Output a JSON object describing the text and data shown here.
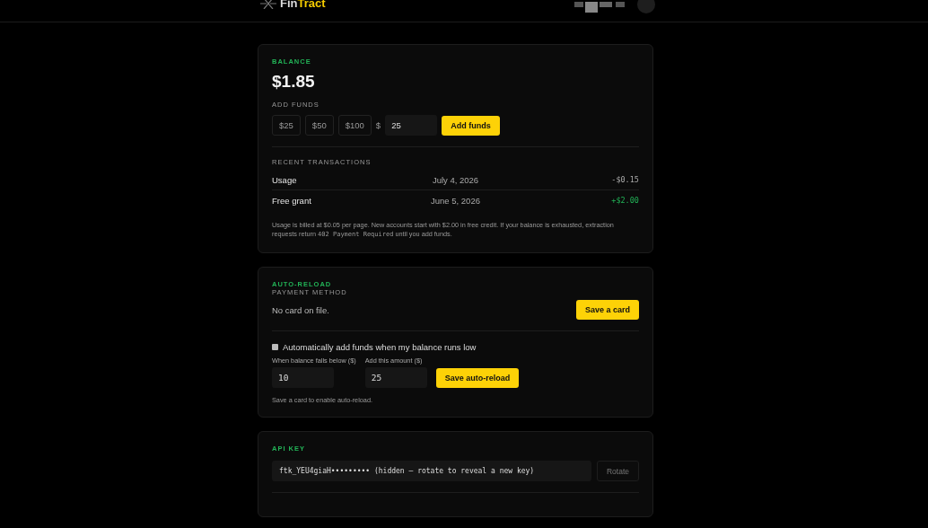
{
  "header": {
    "brand": {
      "text": "Fin",
      "accent": "Tract"
    }
  },
  "balance": {
    "title": "BALANCE",
    "amount": "$1.85",
    "add_funds_label": "ADD FUNDS",
    "presets": [
      "$25",
      "$50",
      "$100"
    ],
    "currency": "$",
    "amount_value": "25",
    "add_button": "Add funds",
    "transactions_title": "RECENT TRANSACTIONS",
    "transactions": [
      {
        "name": "Usage",
        "date": "July 4, 2026",
        "amount": "-$0.15",
        "kind": "debit"
      },
      {
        "name": "Free grant",
        "date": "June 5, 2026",
        "amount": "+$2.00",
        "kind": "credit"
      }
    ],
    "note": {
      "before": "Usage is billed at $0.05 per page. New accounts start with $2.00 in free credit. If your balance is exhausted, extraction requests return ",
      "code": "402 Payment Required",
      "after": " until you add funds."
    }
  },
  "auto_reload": {
    "title": "AUTO-RELOAD",
    "payment_label": "PAYMENT METHOD",
    "payment_text": "No card on file.",
    "save_card_button": "Save a card",
    "checkbox": {
      "label": "Automatically add funds when my balance runs low",
      "checked": false
    },
    "fields": [
      {
        "label": "When balance falls below ($)",
        "value": "10"
      },
      {
        "label": "Add this amount ($)",
        "value": "25"
      }
    ],
    "save_button": "Save auto-reload",
    "hint": "Save a card to enable auto-reload."
  },
  "api_key": {
    "title": "API KEY",
    "value": "ftk_YEU4giaH••••••••• (hidden — rotate to reveal a new key)",
    "rotate_button": "Rotate"
  }
}
